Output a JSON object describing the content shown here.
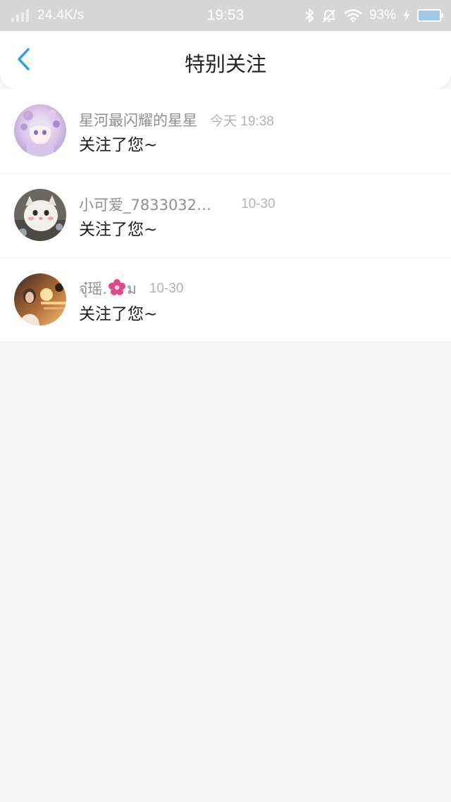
{
  "status_bar": {
    "net_speed": "24.4K/s",
    "time": "19:53",
    "battery_pct": "93%",
    "icons": [
      "signal-icon",
      "bluetooth-icon",
      "mute-bell-icon",
      "wifi-icon",
      "charging-icon",
      "battery-icon"
    ]
  },
  "header": {
    "title": "特别关注",
    "back_icon": "chevron-left-icon",
    "accent_color": "#2b9bf0"
  },
  "items": [
    {
      "username": "星河最闪耀的星星",
      "time": "今天 19:38",
      "message": "关注了您~"
    },
    {
      "username": "小可爱_7833032…",
      "time": "10-30",
      "message": "关注了您~"
    },
    {
      "username_prefix": "จุ๋瑶.",
      "username_icon": "flower-icon",
      "username_suffix": "ม",
      "time": "10-30",
      "message": "关注了您~"
    }
  ]
}
